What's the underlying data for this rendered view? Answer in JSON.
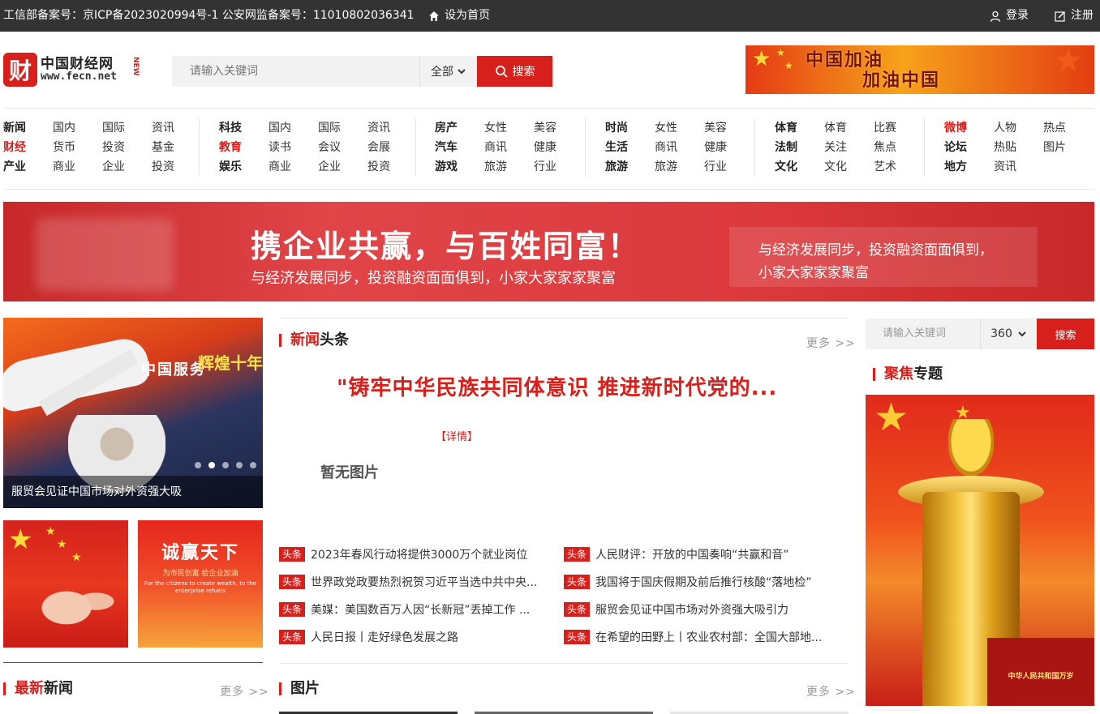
{
  "topbar": {
    "icp": "工信部备案号：京ICP备2023020994号-1 公安网监备案号：11010802036341",
    "home": "设为首页",
    "login": "登录",
    "register": "注册"
  },
  "logo": {
    "cn": "中国财经网",
    "en": "www.fecn.net",
    "new": "NEW",
    "mark": "财"
  },
  "search": {
    "placeholder": "请输入关键词",
    "scope": "全部",
    "button": "搜索"
  },
  "top_banner": {
    "line1": "中国加油",
    "line2": "加油中国"
  },
  "nav": [
    {
      "rows": [
        [
          "新闻",
          "国内",
          "国际",
          "资讯"
        ],
        [
          "财经",
          "货币",
          "投资",
          "基金"
        ],
        [
          "产业",
          "商业",
          "企业",
          "投资"
        ]
      ]
    },
    {
      "rows": [
        [
          "科技",
          "国内",
          "国际",
          "资讯"
        ],
        [
          "教育",
          "读书",
          "会议",
          "会展"
        ],
        [
          "娱乐",
          "商业",
          "企业",
          "投资"
        ]
      ]
    },
    {
      "rows": [
        [
          "房产",
          "女性",
          "美容"
        ],
        [
          "汽车",
          "商讯",
          "健康"
        ],
        [
          "游戏",
          "旅游",
          "行业"
        ]
      ]
    },
    {
      "rows": [
        [
          "时尚",
          "女性",
          "美容"
        ],
        [
          "生活",
          "商讯",
          "健康"
        ],
        [
          "旅游",
          "旅游",
          "行业"
        ]
      ]
    },
    {
      "rows": [
        [
          "体育",
          "体育",
          "比赛"
        ],
        [
          "法制",
          "关注",
          "焦点"
        ],
        [
          "文化",
          "文化",
          "艺术"
        ]
      ]
    },
    {
      "rows": [
        [
          "微博",
          "人物",
          "热点"
        ],
        [
          "论坛",
          "热贴",
          "图片"
        ],
        [
          "地方",
          "资讯"
        ]
      ]
    }
  ],
  "big_banner": {
    "headline": "携企业共赢，与百姓同富！",
    "sub": "与经济发展同步，投资融资面面俱到，小家大家家家聚富",
    "box_line1": "与经济发展同步，投资融资面面俱到，",
    "box_line2": "小家大家家家聚富"
  },
  "slider": {
    "caption": "服贸会见证中国市场对外资强大吸",
    "sign1": "中国服务",
    "sign2": "辉煌十年",
    "dots": 5,
    "active_dot": 2
  },
  "thumb2": {
    "t1": "诚赢天下",
    "t2": "为市民创富 给企业加油",
    "t3": "For the citizens to create wealth, to the enterprise refuels"
  },
  "latest": {
    "title_red": "最新",
    "title_rest": "新闻",
    "more": "更多 >>"
  },
  "headlines": {
    "title_red": "新闻",
    "title_rest": "头条",
    "more": "更多 >>",
    "main": "\"铸牢中华民族共同体意识 推进新时代党的...",
    "detail": "【详情】",
    "noimg": "暂无图片",
    "tag": "头条",
    "left": [
      "2023年春风行动将提供3000万个就业岗位",
      "世界政党政要热烈祝贺习近平当选中共中央...",
      "美媒：美国数百万人因“长新冠”丢掉工作 ...",
      "人民日报丨走好绿色发展之路"
    ],
    "right": [
      "人民财评：开放的中国奏响“共赢和音”",
      "我国将于国庆假期及前后推行核酸“落地检”",
      "服贸会见证中国市场对外资强大吸引力",
      "在希望的田野上丨农业农村部：全国大部地..."
    ]
  },
  "pictures": {
    "title": "图片",
    "more": "更多 >>"
  },
  "right": {
    "placeholder": "请输入关键词",
    "scope": "360",
    "button": "搜索",
    "topic_red": "聚焦",
    "topic_rest": "专题",
    "gate_label": "中华人民共和国万岁"
  },
  "colors": {
    "accent": "#d7201c",
    "topbar": "#333333"
  }
}
